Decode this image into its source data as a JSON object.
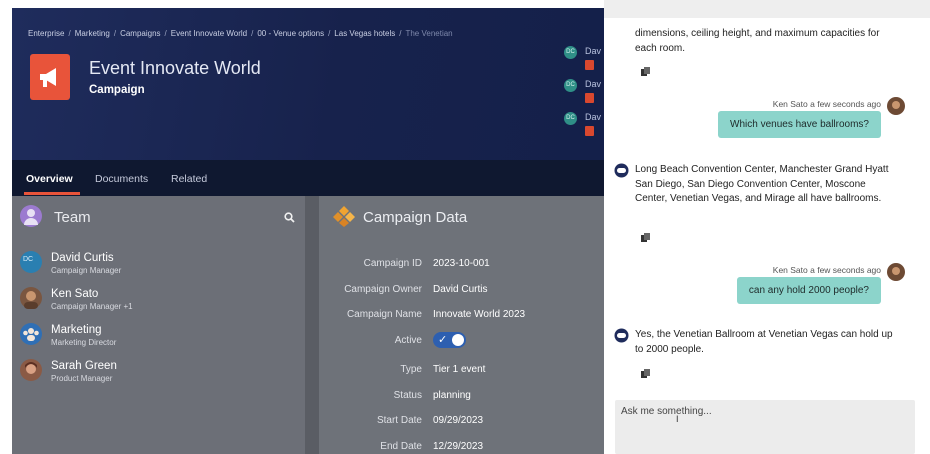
{
  "breadcrumb": {
    "items": [
      "Enterprise",
      "Marketing",
      "Campaigns",
      "Event Innovate World",
      "00 - Venue options",
      "Las Vegas hotels"
    ],
    "current": "The Venetian",
    "separator": "/"
  },
  "header": {
    "title": "Event Innovate World",
    "subtitle": "Campaign",
    "icon": "megaphone-icon",
    "icon_color": "#e8543a"
  },
  "people_strip": [
    {
      "initials": "DC",
      "name": "Dav"
    },
    {
      "initials": "DC",
      "name": "Dav"
    },
    {
      "initials": "DC",
      "name": "Dav"
    }
  ],
  "tabs": [
    {
      "label": "Overview",
      "active": true
    },
    {
      "label": "Documents",
      "active": false
    },
    {
      "label": "Related",
      "active": false
    }
  ],
  "team": {
    "title": "Team",
    "members": [
      {
        "name": "David Curtis",
        "role": "Campaign Manager",
        "avatar": "initials-DC"
      },
      {
        "name": "Ken Sato",
        "role": "Campaign Manager +1",
        "avatar": "photo"
      },
      {
        "name": "Marketing",
        "role": "Marketing Director",
        "avatar": "group-icon"
      },
      {
        "name": "Sarah Green",
        "role": "Product Manager",
        "avatar": "photo"
      }
    ]
  },
  "campaign_data": {
    "title": "Campaign Data",
    "fields": [
      {
        "label": "Campaign ID",
        "value": "2023-10-001"
      },
      {
        "label": "Campaign Owner",
        "value": "David Curtis"
      },
      {
        "label": "Campaign Name",
        "value": "Innovate World 2023"
      },
      {
        "label": "Active",
        "value": "true"
      },
      {
        "label": "Type",
        "value": "Tier 1 event"
      },
      {
        "label": "Status",
        "value": "planning"
      },
      {
        "label": "Start Date",
        "value": "09/29/2023"
      },
      {
        "label": "End Date",
        "value": "12/29/2023"
      }
    ]
  },
  "chat": {
    "messages": [
      {
        "from": "bot",
        "text": "dimensions, ceiling height, and maximum capacities for each room."
      },
      {
        "from": "user",
        "meta": "Ken Sato a few seconds ago",
        "text": "Which venues have ballrooms?"
      },
      {
        "from": "bot",
        "text": "Long Beach Convention Center, Manchester Grand Hyatt San Diego, San Diego Convention Center, Moscone Center, Venetian Vegas, and Mirage all have ballrooms."
      },
      {
        "from": "user",
        "meta": "Ken Sato a few seconds ago",
        "text": "can any hold 2000 people?"
      },
      {
        "from": "bot",
        "text": "Yes, the Venetian Ballroom at Venetian Vegas can hold up to 2000 people."
      }
    ],
    "input_placeholder": "Ask me something..."
  },
  "colors": {
    "accent": "#e8543a",
    "user_bubble": "#8cd4cb",
    "toggle_on": "#2d5fb0",
    "header_bg": "#1f2c5c"
  }
}
